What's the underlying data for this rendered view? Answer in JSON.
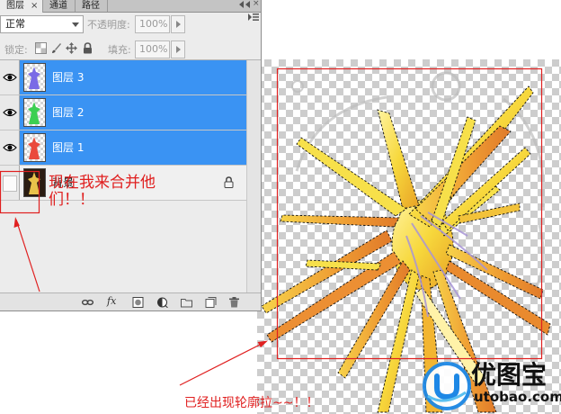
{
  "panel": {
    "tabs": [
      {
        "label": "图层",
        "active": true
      },
      {
        "label": "通道",
        "active": false
      },
      {
        "label": "路径",
        "active": false
      }
    ],
    "tab_close_icon": "close-icon",
    "panel_icons": [
      "double-chevron-left-icon",
      "close-icon",
      "panel-menu-icon"
    ],
    "blend_mode": "正常",
    "opacity_label": "不透明度:",
    "opacity_value": "100%",
    "lock_label": "锁定:",
    "lock_icons": [
      "lock-transparency-icon",
      "lock-pixels-brush-icon",
      "lock-position-move-icon",
      "lock-all-padlock-icon"
    ],
    "fill_label": "填充:",
    "fill_value": "100%",
    "layers": [
      {
        "name": "图层 3",
        "selected": true,
        "visible": true,
        "thumb_color": "#7a6be6"
      },
      {
        "name": "图层 2",
        "selected": true,
        "visible": true,
        "thumb_color": "#3ccf52"
      },
      {
        "name": "图层 1",
        "selected": true,
        "visible": true,
        "thumb_color": "#ea4a3c"
      },
      {
        "name": "背景",
        "selected": false,
        "visible": false,
        "locked": true,
        "thumb_color": "#e8c24a"
      }
    ],
    "footer_icons": [
      "link-layers-icon",
      "fx-icon",
      "layer-mask-icon",
      "adjustment-layer-icon",
      "group-folder-icon",
      "new-layer-icon",
      "trash-icon"
    ],
    "fx_glyph": "fx"
  },
  "annotations": {
    "merge_note": "现在我来合并他们！！",
    "outline_note": "已经出现轮廓拉~~！！",
    "color": "#e02020"
  },
  "watermark": {
    "name": "优图宝",
    "domain": "utobao.com",
    "logo_color": "#1e88e5"
  },
  "colors": {
    "selection_blue": "#3a93f3",
    "panel_bg": "#ececec",
    "figure_gold": "#f2b531",
    "figure_yellow": "#f7e04a",
    "figure_orange": "#e9822a"
  }
}
